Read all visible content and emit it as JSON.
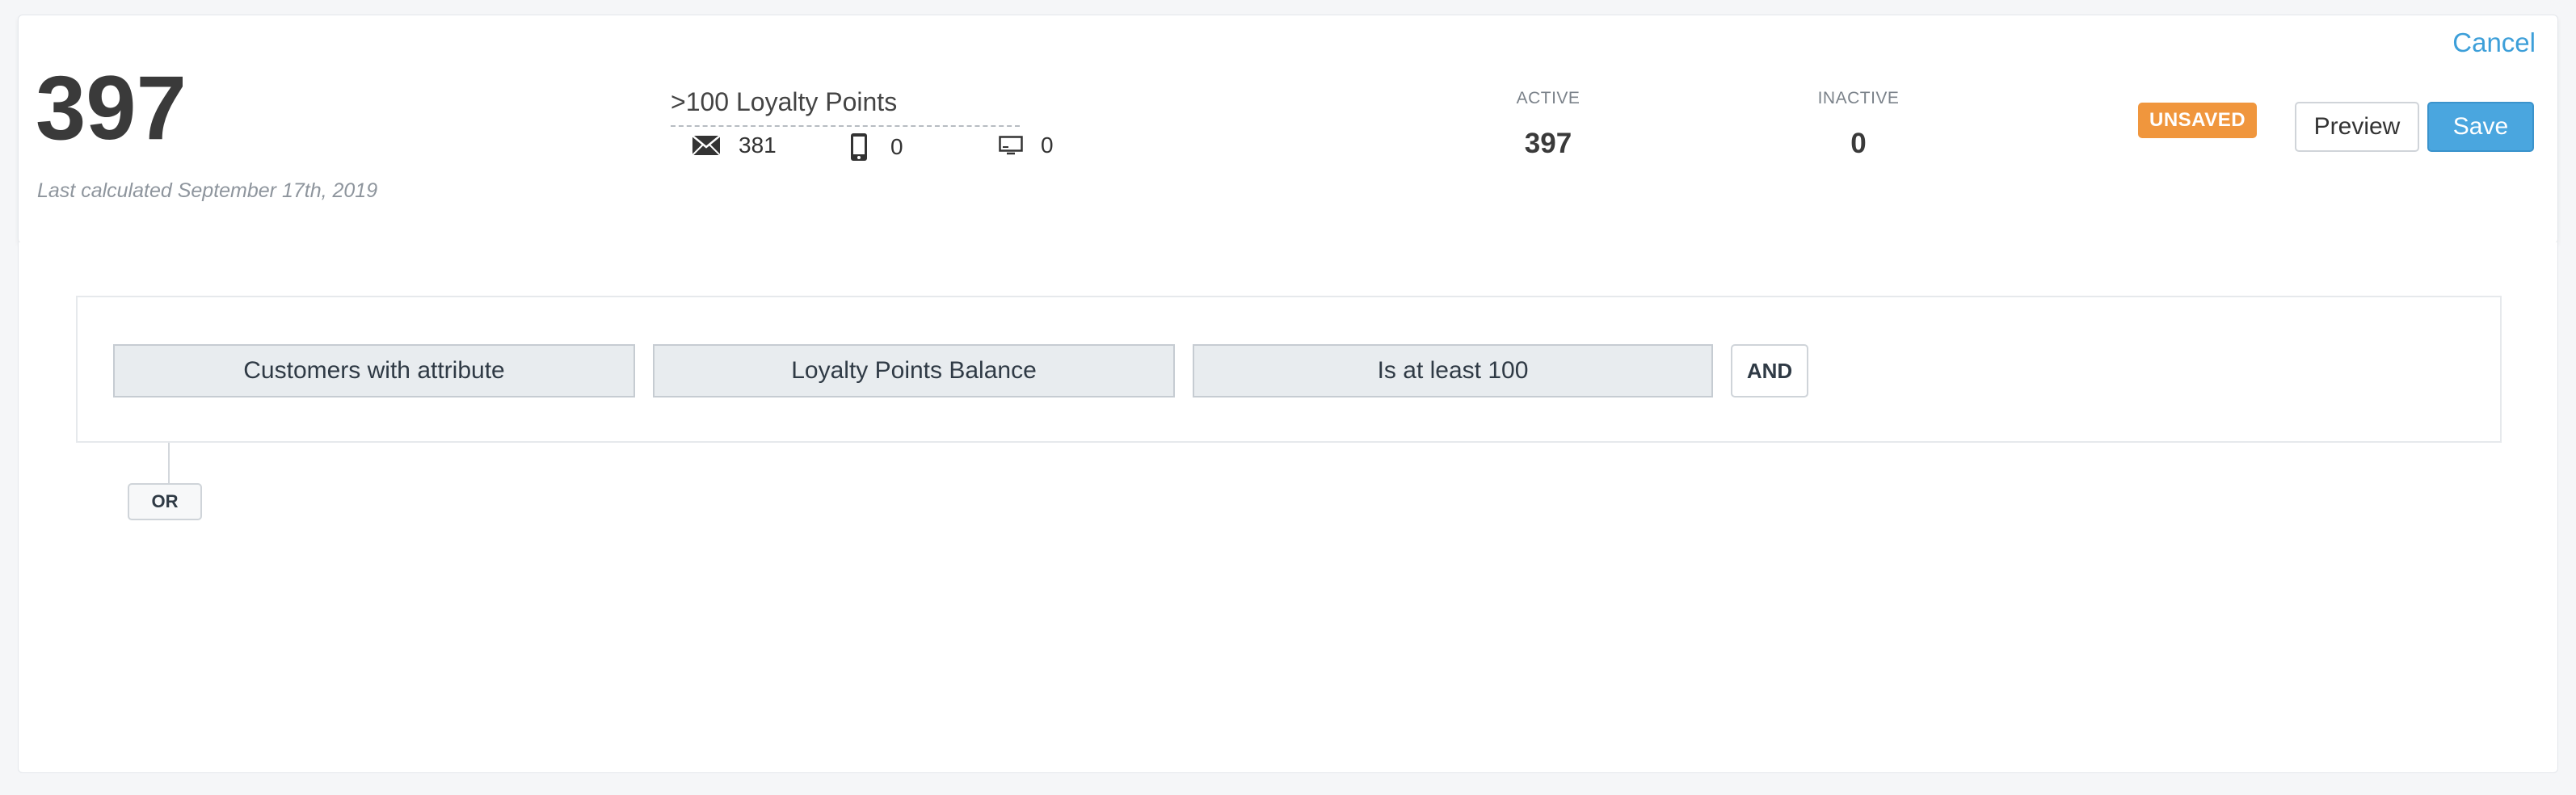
{
  "header": {
    "total_count": "397",
    "last_calculated": "Last calculated September 17th, 2019",
    "segment_name": ">100 Loyalty Points",
    "channels": [
      {
        "icon": "email-icon",
        "value": "381"
      },
      {
        "icon": "mobile-icon",
        "value": "0"
      },
      {
        "icon": "web-icon",
        "value": "0"
      }
    ],
    "active_label": "ACTIVE",
    "active_value": "397",
    "inactive_label": "INACTIVE",
    "inactive_value": "0",
    "status_badge": "UNSAVED",
    "cancel_label": "Cancel",
    "preview_label": "Preview",
    "save_label": "Save"
  },
  "builder": {
    "conditions": [
      {
        "label": "Customers with attribute"
      },
      {
        "label": "Loyalty Points Balance"
      },
      {
        "label": "Is at least 100"
      }
    ],
    "and_label": "AND",
    "or_label": "OR"
  },
  "colors": {
    "accent": "#4aa6df",
    "badge": "#f0963d",
    "link": "#3d9fd9"
  }
}
